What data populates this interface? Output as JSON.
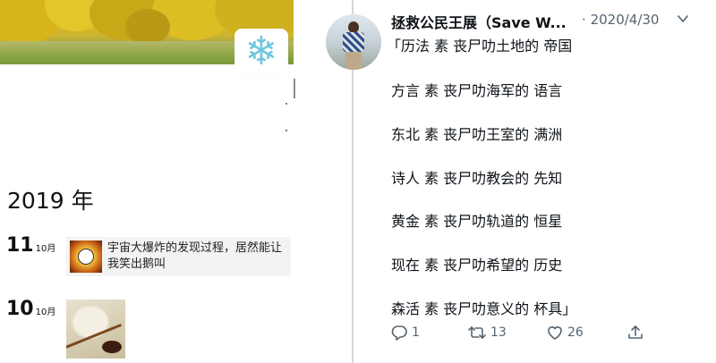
{
  "left_panel": {
    "year_heading": "2019 年",
    "entries": [
      {
        "day": "11",
        "month": "10月",
        "headline": "宇宙大爆炸的发现过程，居然能让我笑出鹅叫"
      },
      {
        "day": "10",
        "month": "10月"
      }
    ],
    "snow_icon": "snowflake-icon"
  },
  "tweet": {
    "author_name": "拯救公民王展（Save W...",
    "separator": "·",
    "date": "2020/4/30",
    "lines": [
      "「历法 素 丧尸叻土地的 帝国",
      "方言 素 丧尸叻海军的 语言",
      "东北 素 丧尸叻王室的 满洲",
      "诗人 素 丧尸叻教会的 先知",
      "黄金 素 丧尸叻轨道的 恒星",
      "现在 素 丧尸叻希望的 历史",
      "森活 素 丧尸叻意义的 杯具」"
    ],
    "actions": {
      "reply_count": "1",
      "retweet_count": "13",
      "like_count": "26"
    }
  },
  "colors": {
    "text_primary": "#0f1419",
    "text_secondary": "#536471",
    "snowflake": "#6fc7dd"
  }
}
